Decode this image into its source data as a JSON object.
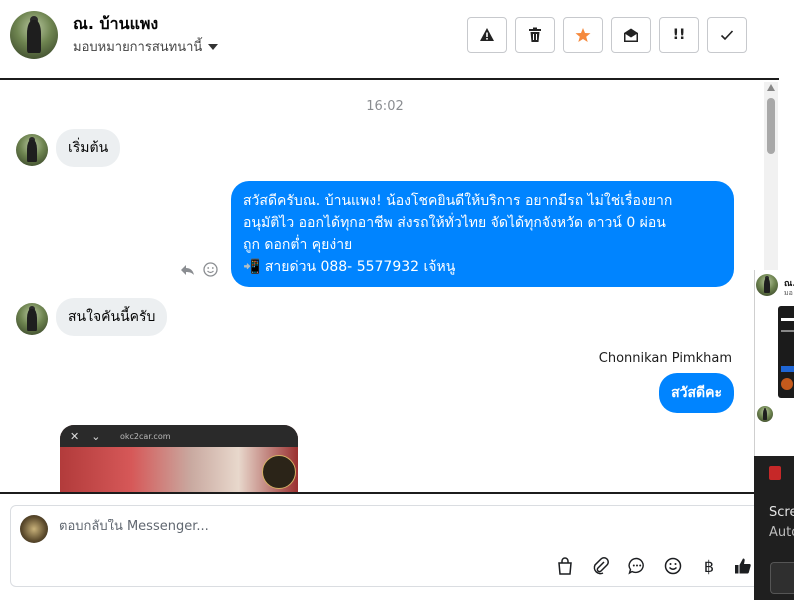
{
  "header": {
    "name": "ณ. บ้านแพง",
    "assign_label": "มอบหมายการสนทนานี้",
    "tools": [
      {
        "icon": "warning-icon",
        "glyph": "⚠"
      },
      {
        "icon": "trash-icon",
        "glyph": "🗑"
      },
      {
        "icon": "star-icon",
        "glyph": "★",
        "color": "#f5893d"
      },
      {
        "icon": "envelope-open-icon",
        "glyph": "✉"
      },
      {
        "icon": "priority-icon",
        "glyph": "!!"
      },
      {
        "icon": "check-icon",
        "glyph": "✓"
      }
    ]
  },
  "conversation": {
    "time": "16:02",
    "messages": [
      {
        "direction": "in",
        "text": "เริ่มต้น"
      },
      {
        "direction": "out",
        "lines": [
          "สวัสดีครับณ. บ้านแพง! น้องโชคยินดีให้บริการ อยากมีรถ ไม่ใช่เรื่องยาก",
          "อนุมัติไว ออกได้ทุกอาชีพ ส่งรถให้ทั่วไทย จัดได้ทุกจังหวัด ดาวน์ 0  ผ่อน",
          "ถูก ดอกต่ำ คุยง่าย",
          "📲 สายด่วน 088- 5577932 เจ้หนู"
        ]
      },
      {
        "direction": "in",
        "text": "สนใจคันนี้ครับ"
      },
      {
        "direction": "out",
        "sender": "Chonnikan Pimkham",
        "text": "สวัสดีคะ"
      }
    ],
    "image_url_text": "okc2car.com"
  },
  "reply": {
    "placeholder": "ตอบกลับใน Messenger..."
  },
  "side_panel": {
    "name": "ณ.",
    "sub": "มอ",
    "text1": "Scre",
    "text2": "Auto"
  },
  "colors": {
    "brand_blue": "#0084ff",
    "incoming_bubble": "#eceff1",
    "star": "#f5893d"
  }
}
